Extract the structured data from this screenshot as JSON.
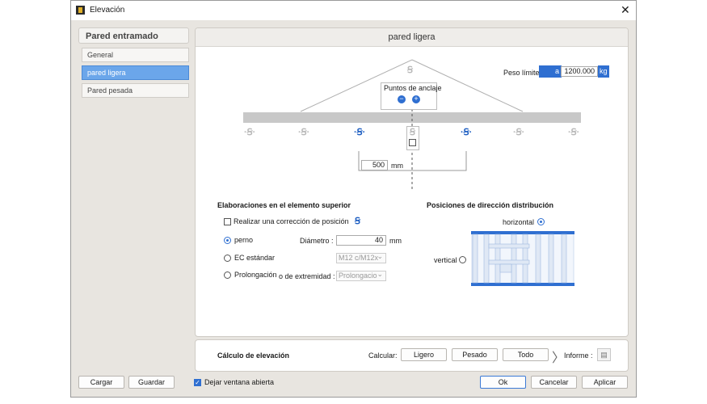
{
  "window": {
    "title": "Elevación"
  },
  "sidebar": {
    "heading": "Pared entramado",
    "items": [
      {
        "label": "General",
        "active": false
      },
      {
        "label": "pared ligera",
        "active": true
      },
      {
        "label": "Pared pesada",
        "active": false
      }
    ]
  },
  "main": {
    "heading": "pared ligera",
    "weight_limit": {
      "label": "Peso límite",
      "prefix": "a",
      "value": "1200.000",
      "unit": "kg"
    },
    "anchor": {
      "label": "Puntos de anclaje"
    },
    "spacing": {
      "value": "500",
      "unit": "mm"
    },
    "upper": {
      "title": "Elaboraciones en el elemento superior",
      "correction_label": "Realizar una corrección de posición",
      "perno_label": "perno",
      "diameter_label": "Diámetro :",
      "diameter_value": "40",
      "diameter_unit": "mm",
      "ec_label": "EC estándar",
      "ec_select": "M12 c/M12x",
      "prolong_label": "Prolongación",
      "end_label": "o de extremidad :",
      "end_select": "Prolongacio"
    },
    "direction": {
      "title": "Posiciones de dirección distribución",
      "horizontal": "horizontal",
      "vertical": "vertical"
    }
  },
  "calc": {
    "title": "Cálculo de elevación",
    "calc_label": "Calcular:",
    "light": "Ligero",
    "heavy": "Pesado",
    "all": "Todo",
    "report_label": "Informe :"
  },
  "footer": {
    "load": "Cargar",
    "save": "Guardar",
    "keep_open": "Dejar ventana abierta",
    "ok": "Ok",
    "cancel": "Cancelar",
    "apply": "Aplicar"
  },
  "colors": {
    "accent": "#2f6fd1",
    "selection": "#6ba6ea",
    "beam": "#c8c8c8",
    "wall_frame": "#2f6fd1"
  }
}
